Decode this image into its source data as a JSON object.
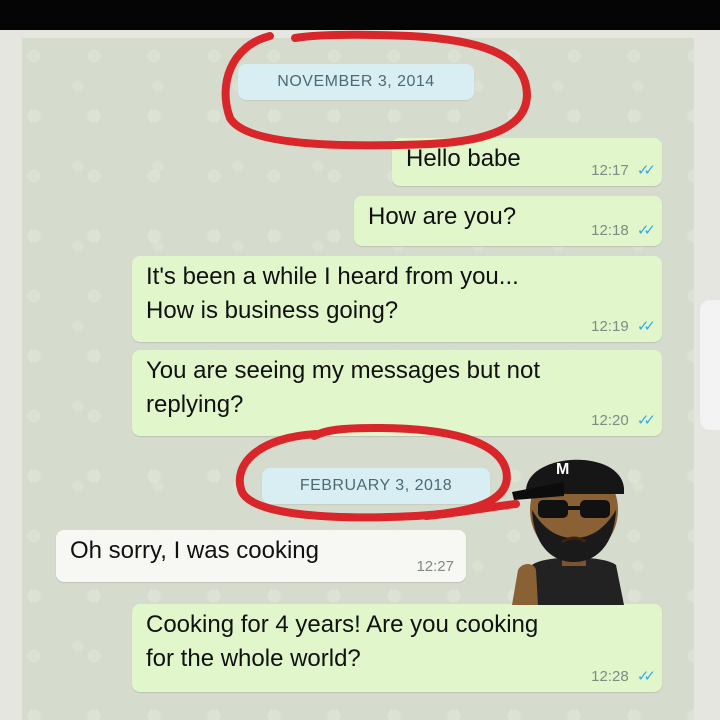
{
  "dates": {
    "first": "NOVEMBER 3, 2014",
    "second": "FEBRUARY 3, 2018"
  },
  "messages": [
    {
      "text": "Hello babe",
      "time": "12:17",
      "dir": "out"
    },
    {
      "text": "How are you?",
      "time": "12:18",
      "dir": "out"
    },
    {
      "line1": "It's been a while I heard from you...",
      "line2": "How is business going?",
      "time": "12:19",
      "dir": "out"
    },
    {
      "line1": "You are seeing my messages but not",
      "line2": "replying?",
      "time": "12:20",
      "dir": "out"
    },
    {
      "text": "Oh sorry, I was cooking",
      "time": "12:27",
      "dir": "in"
    },
    {
      "line1": "Cooking for 4 years! Are you cooking",
      "line2": "for the whole world?",
      "time": "12:28",
      "dir": "out"
    }
  ],
  "read_tick": "✓✓",
  "colors": {
    "outgoing_bubble": "#e1f6cb",
    "incoming_bubble": "#f7f7f4",
    "date_pill": "#d8eef3",
    "marker_circle": "#d8262a",
    "read_tick": "#3aa9e0"
  },
  "avatar": {
    "icon": "cartoon-man-avatar-icon",
    "cap_text": "M"
  }
}
